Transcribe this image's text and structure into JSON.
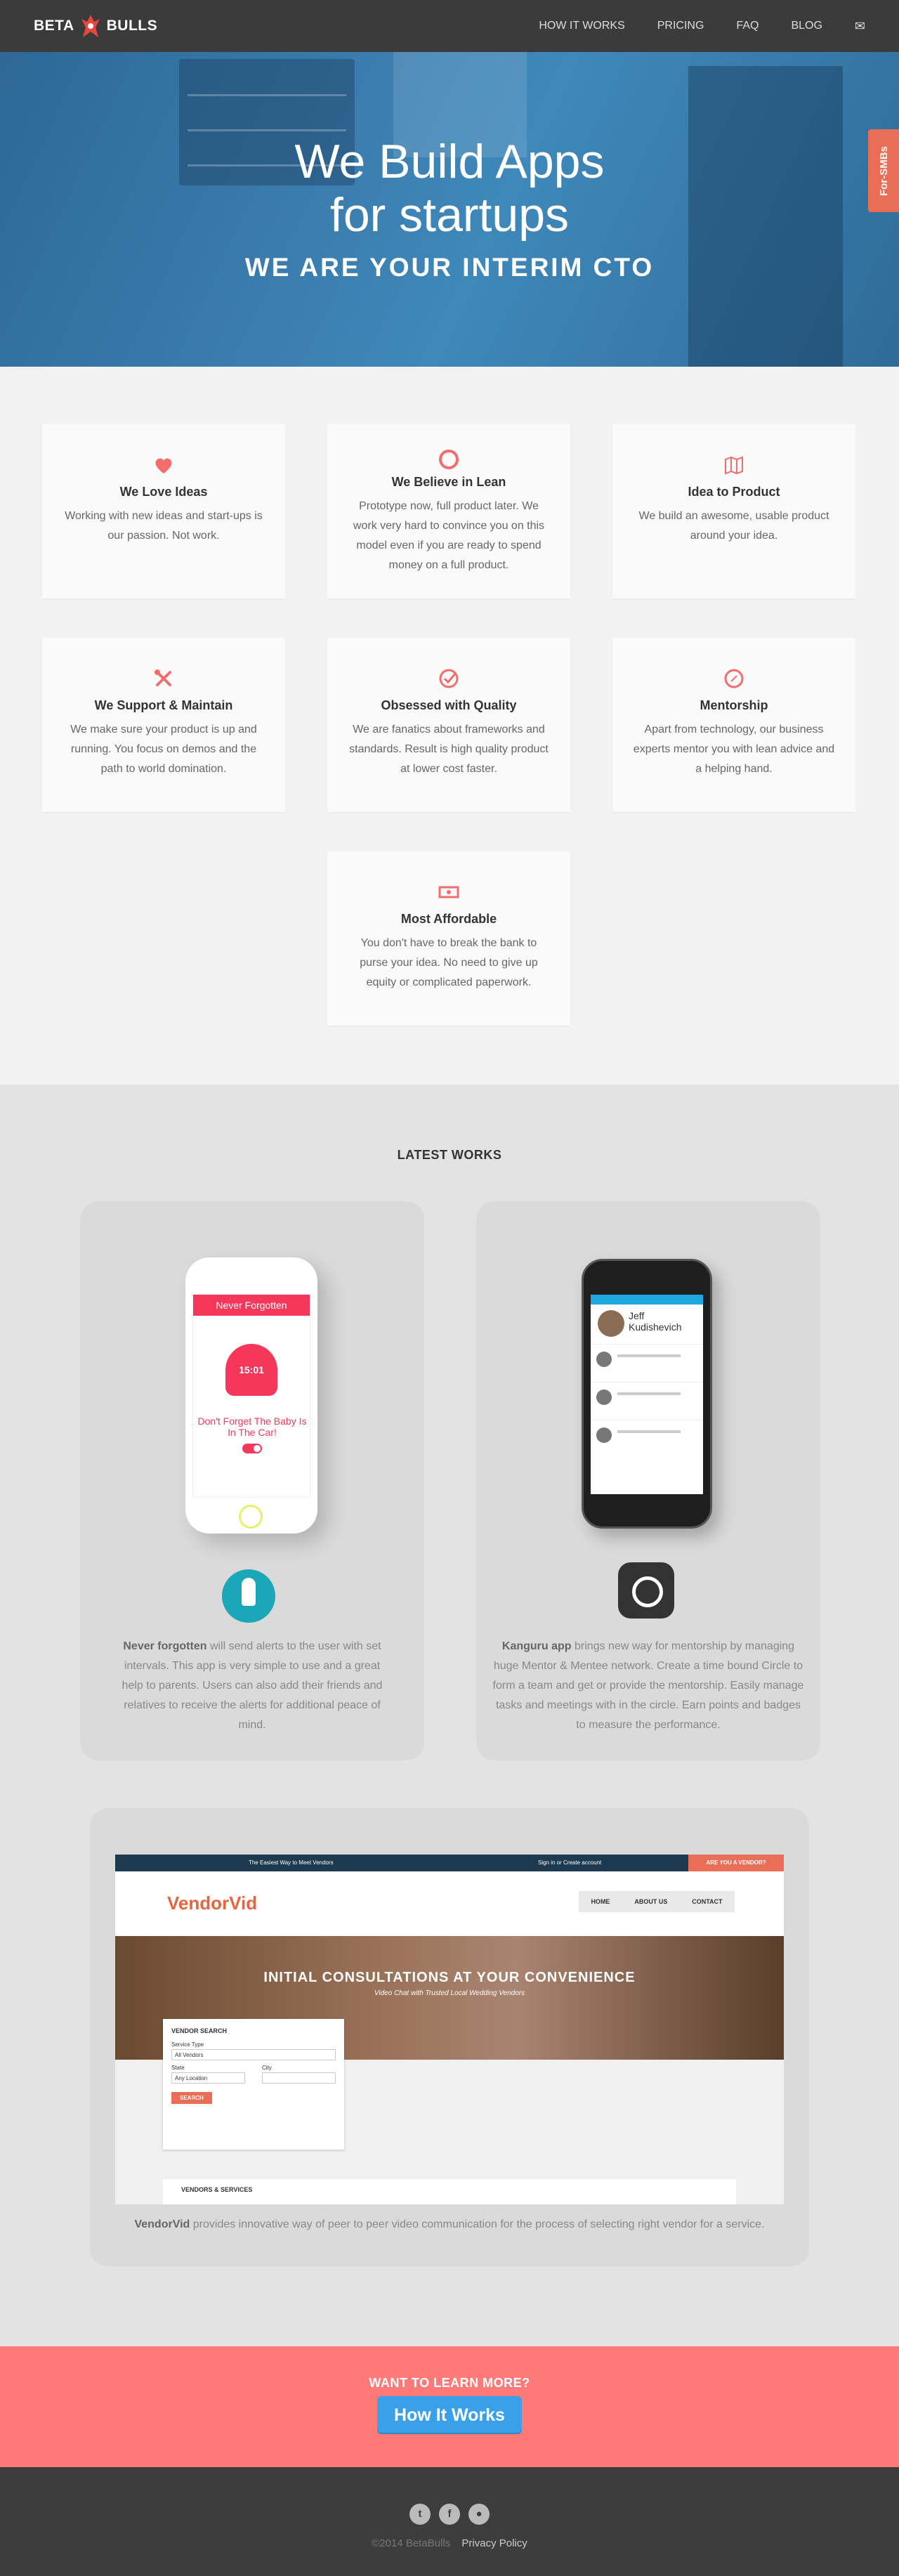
{
  "nav": {
    "brand_left": "BETA",
    "brand_right": "BULLS",
    "items": [
      "HOW IT WORKS",
      "PRICING",
      "FAQ",
      "BLOG"
    ],
    "mail_icon": "mail-icon"
  },
  "hero": {
    "title_line1": "We Build Apps",
    "title_line2": "for startups",
    "subtitle": "WE ARE YOUR INTERIM CTO",
    "side_tab": "For-SMBs"
  },
  "features": [
    {
      "icon": "heart-icon",
      "title": "We Love Ideas",
      "text": "Working with new ideas and start-ups is our passion. Not work."
    },
    {
      "icon": "circle-icon",
      "title": "We Believe in Lean",
      "text": "Prototype now, full product later. We work very hard to convince you on this model even if you are ready to spend money on a full product."
    },
    {
      "icon": "map-icon",
      "title": "Idea to Product",
      "text": "We build an awesome, usable product around your idea."
    },
    {
      "icon": "tools-icon",
      "title": "We Support & Maintain",
      "text": "We make sure your product is up and running. You focus on demos and the path to world domination."
    },
    {
      "icon": "check-circle-icon",
      "title": "Obsessed with Quality",
      "text": "We are fanatics about frameworks and standards. Result is high quality product at lower cost faster."
    },
    {
      "icon": "compass-icon",
      "title": "Mentorship",
      "text": "Apart from technology, our business experts mentor you with lean advice and a helping hand."
    },
    {
      "icon": "money-icon",
      "title": "Most Affordable",
      "text": "You don't have to break the bank to purse your idea. No need to give up equity or complicated paperwork."
    }
  ],
  "works": {
    "title": "LATEST WORKS",
    "app1": {
      "screen_header": "Never Forgotten",
      "timer": "15:01",
      "screen_msg": "Don't Forget The Baby Is In The Car!",
      "name": "Never forgotten",
      "desc": " will send alerts to the user with set intervals. This app is very simple to use and a great help to parents. Users can also add their friends and relatives to receive the alerts for additional peace of mind."
    },
    "app2": {
      "screen_name": "Jeff Kudishevich",
      "name": "Kanguru app",
      "desc": " brings new way for mentorship by managing huge Mentor & Mentee network. Create a time bound Circle to form a team and get or provide the mentorship. Easily manage tasks and meetings with in the circle. Earn points and badges to measure the performance."
    },
    "vendorvid": {
      "top_tagline": "The Easiest Way to Meet Vendors",
      "top_links": "Sign in  or  Create account",
      "top_button": "ARE YOU A VENDOR?",
      "logo_a": "Vendor",
      "logo_b": "Vid",
      "menu": [
        "HOME",
        "ABOUT US",
        "CONTACT"
      ],
      "banner_title": "INITIAL CONSULTATIONS AT YOUR CONVENIENCE",
      "banner_sub": "Video Chat with Trusted Local Wedding Vendors",
      "form_title": "VENDOR SEARCH",
      "service_label": "Service Type",
      "service_value": "All Vendors",
      "state_label": "State",
      "state_value": "Any Location",
      "city_label": "City",
      "search_button": "SEARCH",
      "services_bar": "VENDORS & SERVICES",
      "name": "VendorVid",
      "desc": " provides innovative way of peer to peer video communication for the process of selecting right vendor for a service."
    }
  },
  "cta": {
    "heading": "WANT TO LEARN MORE?",
    "button": "How It Works"
  },
  "footer": {
    "socials": [
      "twitter-icon",
      "facebook-icon",
      "github-icon"
    ],
    "copyright": "©2014 BetaBulls",
    "privacy": "Privacy Policy"
  },
  "colors": {
    "accent": "#fe7a79",
    "nav_bg": "#3b3b3b",
    "hero_blue": "#3a7cad",
    "button_blue": "#3aa0e8",
    "tab_orange": "#ea6d56"
  }
}
